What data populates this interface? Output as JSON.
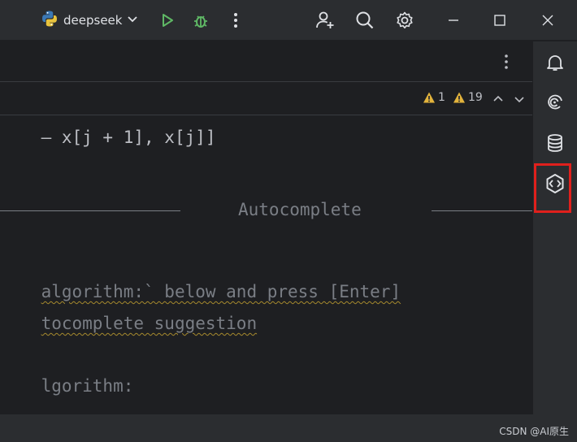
{
  "titlebar": {
    "project_name": "deepseek",
    "icons": [
      "python-logo-icon",
      "chevron-down-icon",
      "run-icon",
      "debug-icon",
      "more-vertical-icon",
      "add-user-icon",
      "search-icon",
      "gear-icon",
      "minimize-icon",
      "maximize-icon",
      "close-icon"
    ]
  },
  "inspections": {
    "warning_count_1": "1",
    "warning_count_2": "19"
  },
  "code": {
    "line_top": "– x[j + 1], x[j]]",
    "separator_title": "Autocomplete",
    "line1": "algorithm:` below and press [Enter]",
    "line2": "tocomplete suggestion",
    "line3": "lgorithm:"
  },
  "toolstrip": {
    "items": [
      "bell-icon",
      "ai-assistant-icon",
      "database-icon",
      "codeium-icon"
    ]
  },
  "status": {
    "watermark": "CSDN @AI原生"
  },
  "colors": {
    "background": "#1e1f22",
    "panel": "#2b2d30",
    "run_green": "#5fb865",
    "warning_yellow": "#e2b33c",
    "highlight_red": "#e0201c"
  }
}
